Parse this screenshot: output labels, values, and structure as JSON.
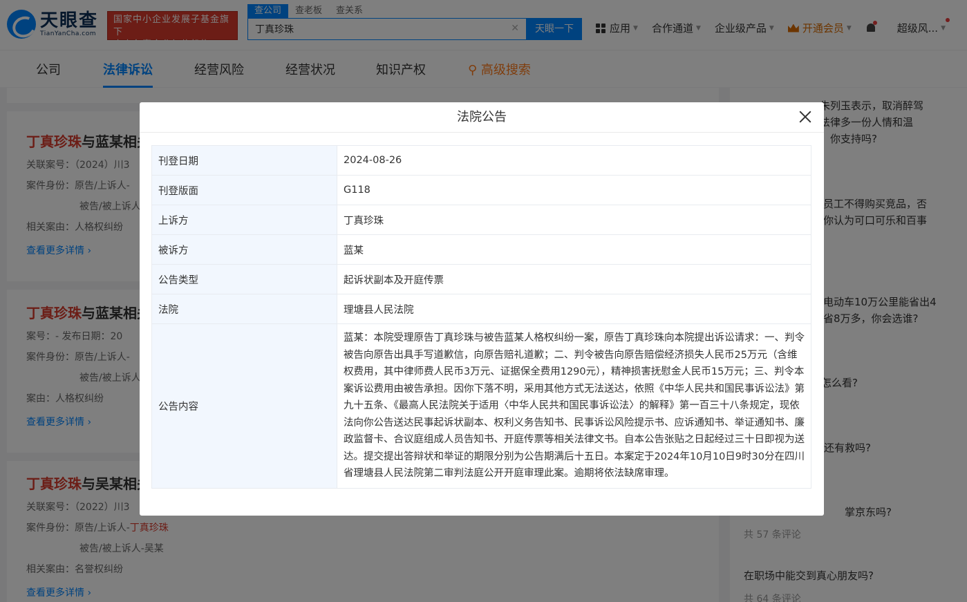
{
  "header": {
    "logo_cn": "天眼查",
    "logo_en": "TianYanCha.com",
    "badge_line1": "国家中小企业发展子基金旗下",
    "badge_line2": "官方备案企业征信机构",
    "search_tabs": [
      "查公司",
      "查老板",
      "查关系"
    ],
    "search_value": "丁真珍珠",
    "search_button": "天眼一下",
    "nav": {
      "apps": "应用",
      "cooperation": "合作通道",
      "enterprise": "企业级产品",
      "vip": "开通会员",
      "user": "超级风..."
    }
  },
  "subnav": [
    "公司",
    "法律诉讼",
    "经营风险",
    "经营状况",
    "知识产权",
    "高级搜索"
  ],
  "cases": [
    {
      "title_hl": "丁真珍珠",
      "title_rest": "与蓝某相关",
      "line1": "关联案号：（2024）川3",
      "line2_prefix": "案件身份：原告/上诉人-",
      "line3": "被告/被上诉人",
      "line4": "相关案由：人格权纠纷",
      "more": "查看更多详情"
    },
    {
      "title_hl": "丁真珍珠",
      "title_rest": "与蓝某相关",
      "line1": "案号：-      发布日期：20",
      "line2_prefix": "案件身份：原告/上诉人-",
      "line3": "被告/被上诉人",
      "line4": "案由：人格权纠纷",
      "more": "查看更多详情"
    },
    {
      "title_hl": "丁真珍珠",
      "title_rest": "与吴某相关",
      "line1": "关联案号：（2022）川3",
      "line2_prefix": "案件身份：原告/上诉人-",
      "line2_hl": "丁真珍珠",
      "line3": "被告/被上诉人-吴某",
      "line4": "相关案由：名誉权纠纷",
      "more": "查看更多详情"
    }
  ],
  "sidebar": {
    "q1_a": "朱列玉表示，取消醉驾",
    "q1_b": "法律多一份人情和温",
    "q1_c": "，你支持吗?",
    "q2_a": "员工不得购买竞品，否",
    "q2_b": "你认为可口可乐和百事",
    "q3_a": "电动车10万公里能省出4",
    "q3_b": "省8万多，你会选谁?",
    "q4": "怎么看?",
    "q5": "还有救吗?",
    "q6": "掌京东吗?",
    "q6_meta": "共 57 条评论",
    "q7": "在职场中能交到真心朋友吗?",
    "q7_meta": "共 64 条评论"
  },
  "modal": {
    "title": "法院公告",
    "rows": [
      {
        "k": "刊登日期",
        "v": "2024-08-26"
      },
      {
        "k": "刊登版面",
        "v": "G118"
      },
      {
        "k": "上诉方",
        "v": "丁真珍珠"
      },
      {
        "k": "被诉方",
        "v": "蓝某"
      },
      {
        "k": "公告类型",
        "v": "起诉状副本及开庭传票"
      },
      {
        "k": "法院",
        "v": "理塘县人民法院"
      },
      {
        "k": "公告内容",
        "v": "蓝某：本院受理原告丁真珍珠与被告蓝某人格权纠纷一案，原告丁真珍珠向本院提出诉讼请求：一、判令被告向原告出具手写道歉信，向原告赔礼道歉；二、判令被告向原告赔偿经济损失人民币25万元（含维权费用，其中律师费人民币3万元、证据保全费用1290元），精神损害抚慰金人民币15万元；三、判令本案诉讼费用由被告承担。因你下落不明，采用其他方式无法送达，依照《中华人民共和国民事诉讼法》第九十五条、《最高人民法院关于适用〈中华人民共和国民事诉讼法〉的解释》第一百三十八条规定，现依法向你公告送达民事起诉状副本、权利义务告知书、民事诉讼风险提示书、应诉通知书、举证通知书、廉政监督卡、合议庭组成人员告知书、开庭传票等相关法律文书。自本公告张贴之日起经过三十日即视为送达。提交提出答辩状和举证的期限分别为公告期满后十五日。本案定于2024年10月10日9时30分在四川省理塘县人民法院第二审判法庭公开开庭审理此案。逾期将依法缺席审理。"
      }
    ]
  }
}
